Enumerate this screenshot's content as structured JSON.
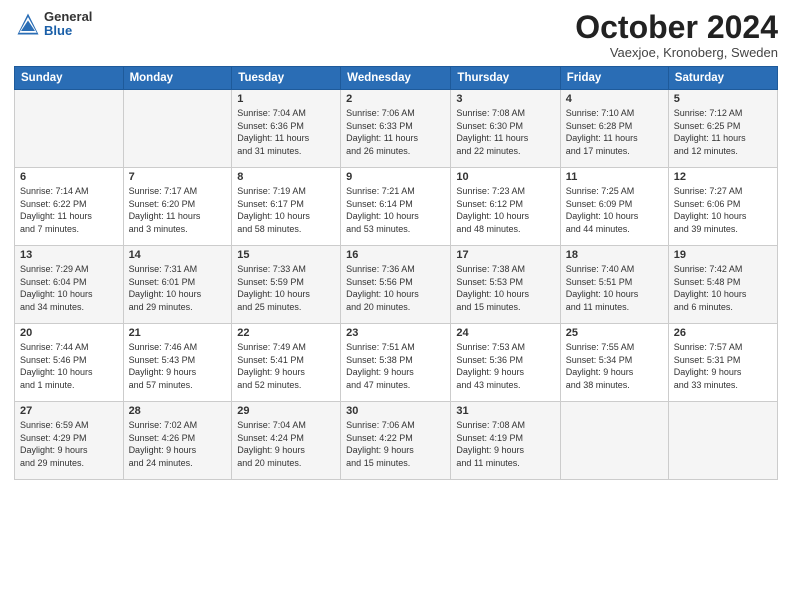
{
  "logo": {
    "general": "General",
    "blue": "Blue"
  },
  "header": {
    "month": "October 2024",
    "location": "Vaexjoe, Kronoberg, Sweden"
  },
  "weekdays": [
    "Sunday",
    "Monday",
    "Tuesday",
    "Wednesday",
    "Thursday",
    "Friday",
    "Saturday"
  ],
  "weeks": [
    [
      {
        "day": "",
        "info": ""
      },
      {
        "day": "",
        "info": ""
      },
      {
        "day": "1",
        "info": "Sunrise: 7:04 AM\nSunset: 6:36 PM\nDaylight: 11 hours\nand 31 minutes."
      },
      {
        "day": "2",
        "info": "Sunrise: 7:06 AM\nSunset: 6:33 PM\nDaylight: 11 hours\nand 26 minutes."
      },
      {
        "day": "3",
        "info": "Sunrise: 7:08 AM\nSunset: 6:30 PM\nDaylight: 11 hours\nand 22 minutes."
      },
      {
        "day": "4",
        "info": "Sunrise: 7:10 AM\nSunset: 6:28 PM\nDaylight: 11 hours\nand 17 minutes."
      },
      {
        "day": "5",
        "info": "Sunrise: 7:12 AM\nSunset: 6:25 PM\nDaylight: 11 hours\nand 12 minutes."
      }
    ],
    [
      {
        "day": "6",
        "info": "Sunrise: 7:14 AM\nSunset: 6:22 PM\nDaylight: 11 hours\nand 7 minutes."
      },
      {
        "day": "7",
        "info": "Sunrise: 7:17 AM\nSunset: 6:20 PM\nDaylight: 11 hours\nand 3 minutes."
      },
      {
        "day": "8",
        "info": "Sunrise: 7:19 AM\nSunset: 6:17 PM\nDaylight: 10 hours\nand 58 minutes."
      },
      {
        "day": "9",
        "info": "Sunrise: 7:21 AM\nSunset: 6:14 PM\nDaylight: 10 hours\nand 53 minutes."
      },
      {
        "day": "10",
        "info": "Sunrise: 7:23 AM\nSunset: 6:12 PM\nDaylight: 10 hours\nand 48 minutes."
      },
      {
        "day": "11",
        "info": "Sunrise: 7:25 AM\nSunset: 6:09 PM\nDaylight: 10 hours\nand 44 minutes."
      },
      {
        "day": "12",
        "info": "Sunrise: 7:27 AM\nSunset: 6:06 PM\nDaylight: 10 hours\nand 39 minutes."
      }
    ],
    [
      {
        "day": "13",
        "info": "Sunrise: 7:29 AM\nSunset: 6:04 PM\nDaylight: 10 hours\nand 34 minutes."
      },
      {
        "day": "14",
        "info": "Sunrise: 7:31 AM\nSunset: 6:01 PM\nDaylight: 10 hours\nand 29 minutes."
      },
      {
        "day": "15",
        "info": "Sunrise: 7:33 AM\nSunset: 5:59 PM\nDaylight: 10 hours\nand 25 minutes."
      },
      {
        "day": "16",
        "info": "Sunrise: 7:36 AM\nSunset: 5:56 PM\nDaylight: 10 hours\nand 20 minutes."
      },
      {
        "day": "17",
        "info": "Sunrise: 7:38 AM\nSunset: 5:53 PM\nDaylight: 10 hours\nand 15 minutes."
      },
      {
        "day": "18",
        "info": "Sunrise: 7:40 AM\nSunset: 5:51 PM\nDaylight: 10 hours\nand 11 minutes."
      },
      {
        "day": "19",
        "info": "Sunrise: 7:42 AM\nSunset: 5:48 PM\nDaylight: 10 hours\nand 6 minutes."
      }
    ],
    [
      {
        "day": "20",
        "info": "Sunrise: 7:44 AM\nSunset: 5:46 PM\nDaylight: 10 hours\nand 1 minute."
      },
      {
        "day": "21",
        "info": "Sunrise: 7:46 AM\nSunset: 5:43 PM\nDaylight: 9 hours\nand 57 minutes."
      },
      {
        "day": "22",
        "info": "Sunrise: 7:49 AM\nSunset: 5:41 PM\nDaylight: 9 hours\nand 52 minutes."
      },
      {
        "day": "23",
        "info": "Sunrise: 7:51 AM\nSunset: 5:38 PM\nDaylight: 9 hours\nand 47 minutes."
      },
      {
        "day": "24",
        "info": "Sunrise: 7:53 AM\nSunset: 5:36 PM\nDaylight: 9 hours\nand 43 minutes."
      },
      {
        "day": "25",
        "info": "Sunrise: 7:55 AM\nSunset: 5:34 PM\nDaylight: 9 hours\nand 38 minutes."
      },
      {
        "day": "26",
        "info": "Sunrise: 7:57 AM\nSunset: 5:31 PM\nDaylight: 9 hours\nand 33 minutes."
      }
    ],
    [
      {
        "day": "27",
        "info": "Sunrise: 6:59 AM\nSunset: 4:29 PM\nDaylight: 9 hours\nand 29 minutes."
      },
      {
        "day": "28",
        "info": "Sunrise: 7:02 AM\nSunset: 4:26 PM\nDaylight: 9 hours\nand 24 minutes."
      },
      {
        "day": "29",
        "info": "Sunrise: 7:04 AM\nSunset: 4:24 PM\nDaylight: 9 hours\nand 20 minutes."
      },
      {
        "day": "30",
        "info": "Sunrise: 7:06 AM\nSunset: 4:22 PM\nDaylight: 9 hours\nand 15 minutes."
      },
      {
        "day": "31",
        "info": "Sunrise: 7:08 AM\nSunset: 4:19 PM\nDaylight: 9 hours\nand 11 minutes."
      },
      {
        "day": "",
        "info": ""
      },
      {
        "day": "",
        "info": ""
      }
    ]
  ]
}
